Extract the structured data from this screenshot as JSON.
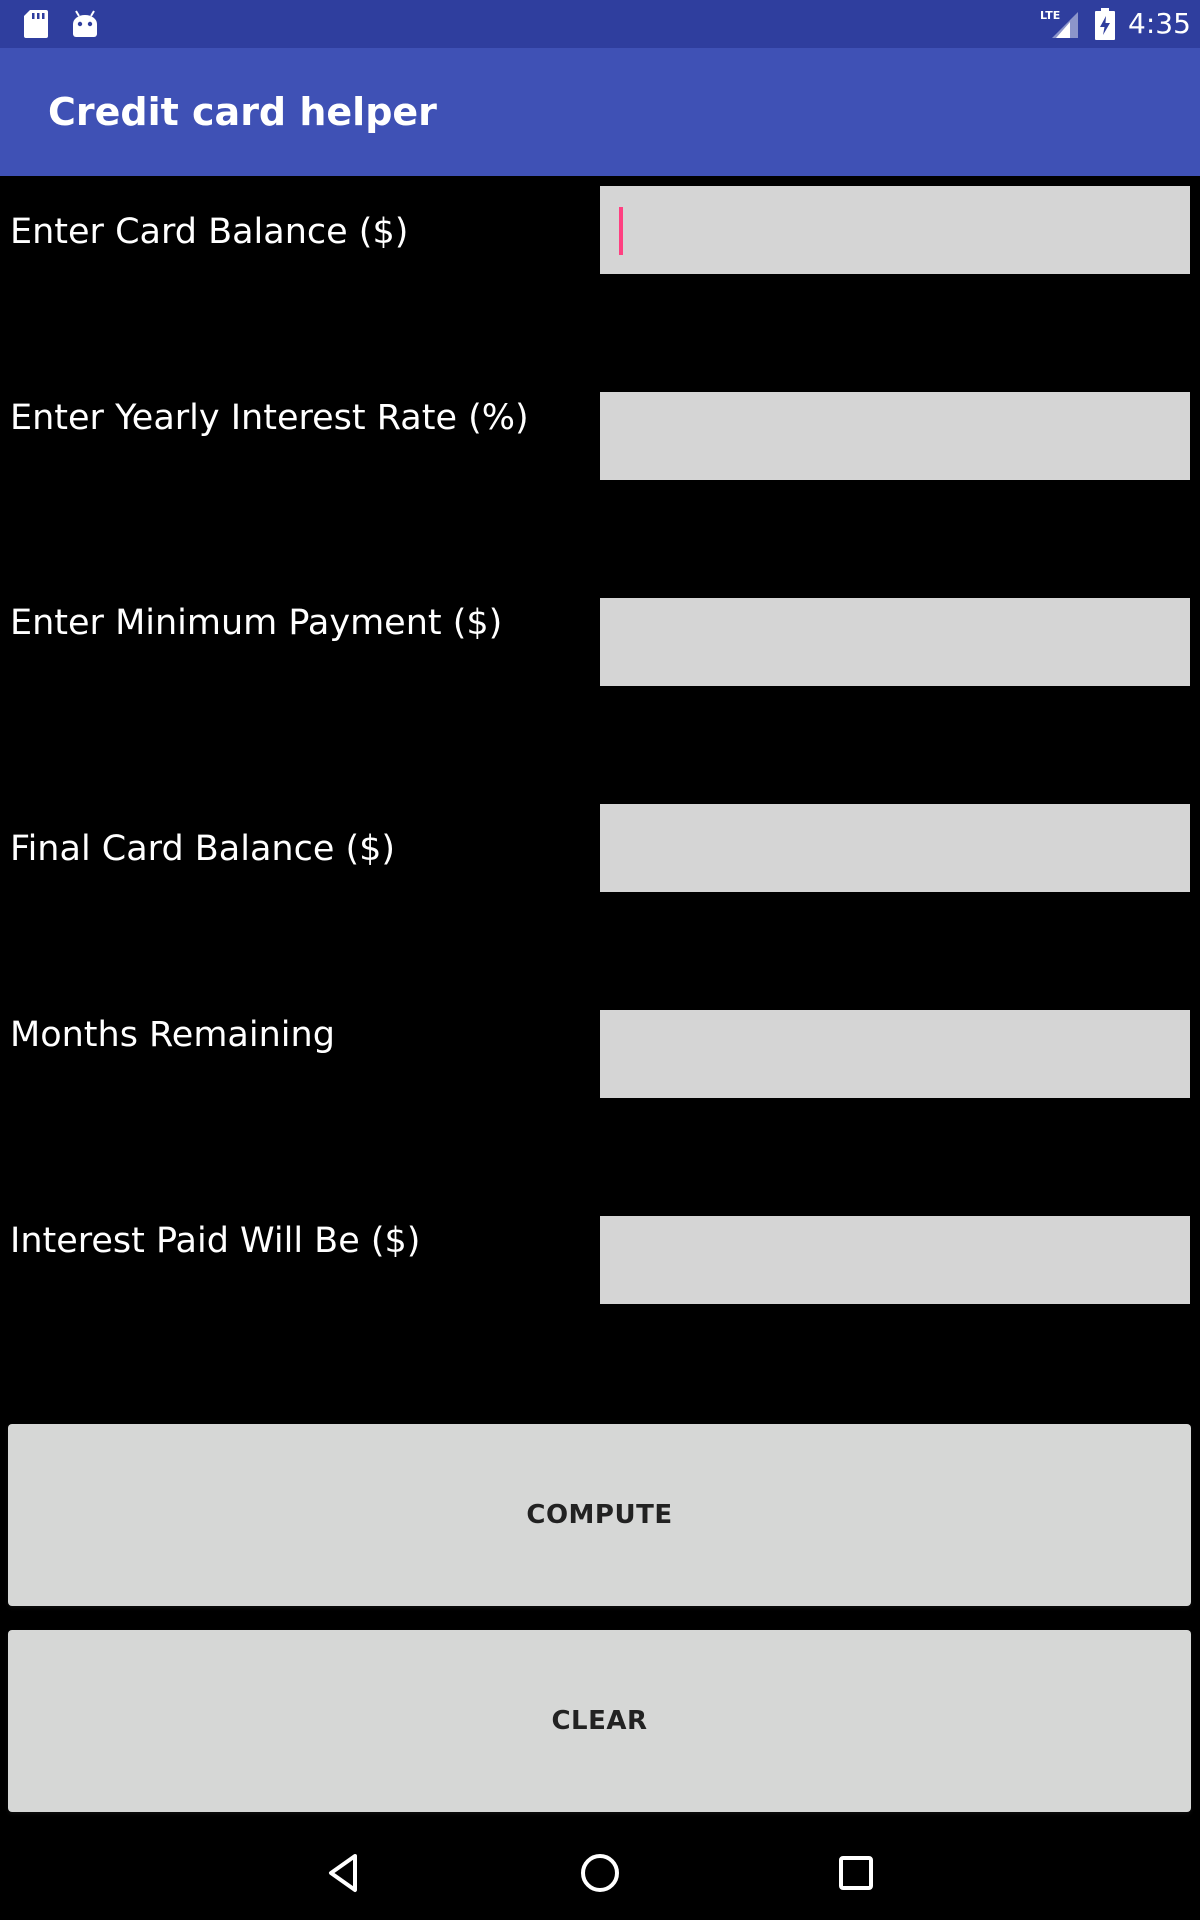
{
  "status_bar": {
    "time": "4:35",
    "network": "LTE",
    "icons": [
      "sd-card-icon",
      "android-debug-icon",
      "lte-signal-icon",
      "battery-charging-icon"
    ]
  },
  "app_bar": {
    "title": "Credit card helper",
    "color": "#3f51b5"
  },
  "form": {
    "card_balance": {
      "label": "Enter Card Balance ($)",
      "value": ""
    },
    "interest_rate": {
      "label": "Enter Yearly Interest Rate (%)",
      "value": ""
    },
    "minimum_payment": {
      "label": "Enter Minimum Payment ($)",
      "value": ""
    },
    "final_balance": {
      "label": "Final Card Balance ($)",
      "value": ""
    },
    "months_remaining": {
      "label": "Months Remaining",
      "value": ""
    },
    "interest_paid": {
      "label": "Interest Paid Will Be ($)",
      "value": ""
    }
  },
  "buttons": {
    "compute": "COMPUTE",
    "clear": "CLEAR"
  },
  "nav_bar": {
    "icons": [
      "back-icon",
      "home-icon",
      "recents-icon"
    ]
  },
  "colors": {
    "status_bar": "#2f3e9e",
    "app_bar": "#3f51b5",
    "background": "#000000",
    "field": "#d5d5d5",
    "button": "#d6d7d6",
    "cursor": "#ff4081"
  }
}
